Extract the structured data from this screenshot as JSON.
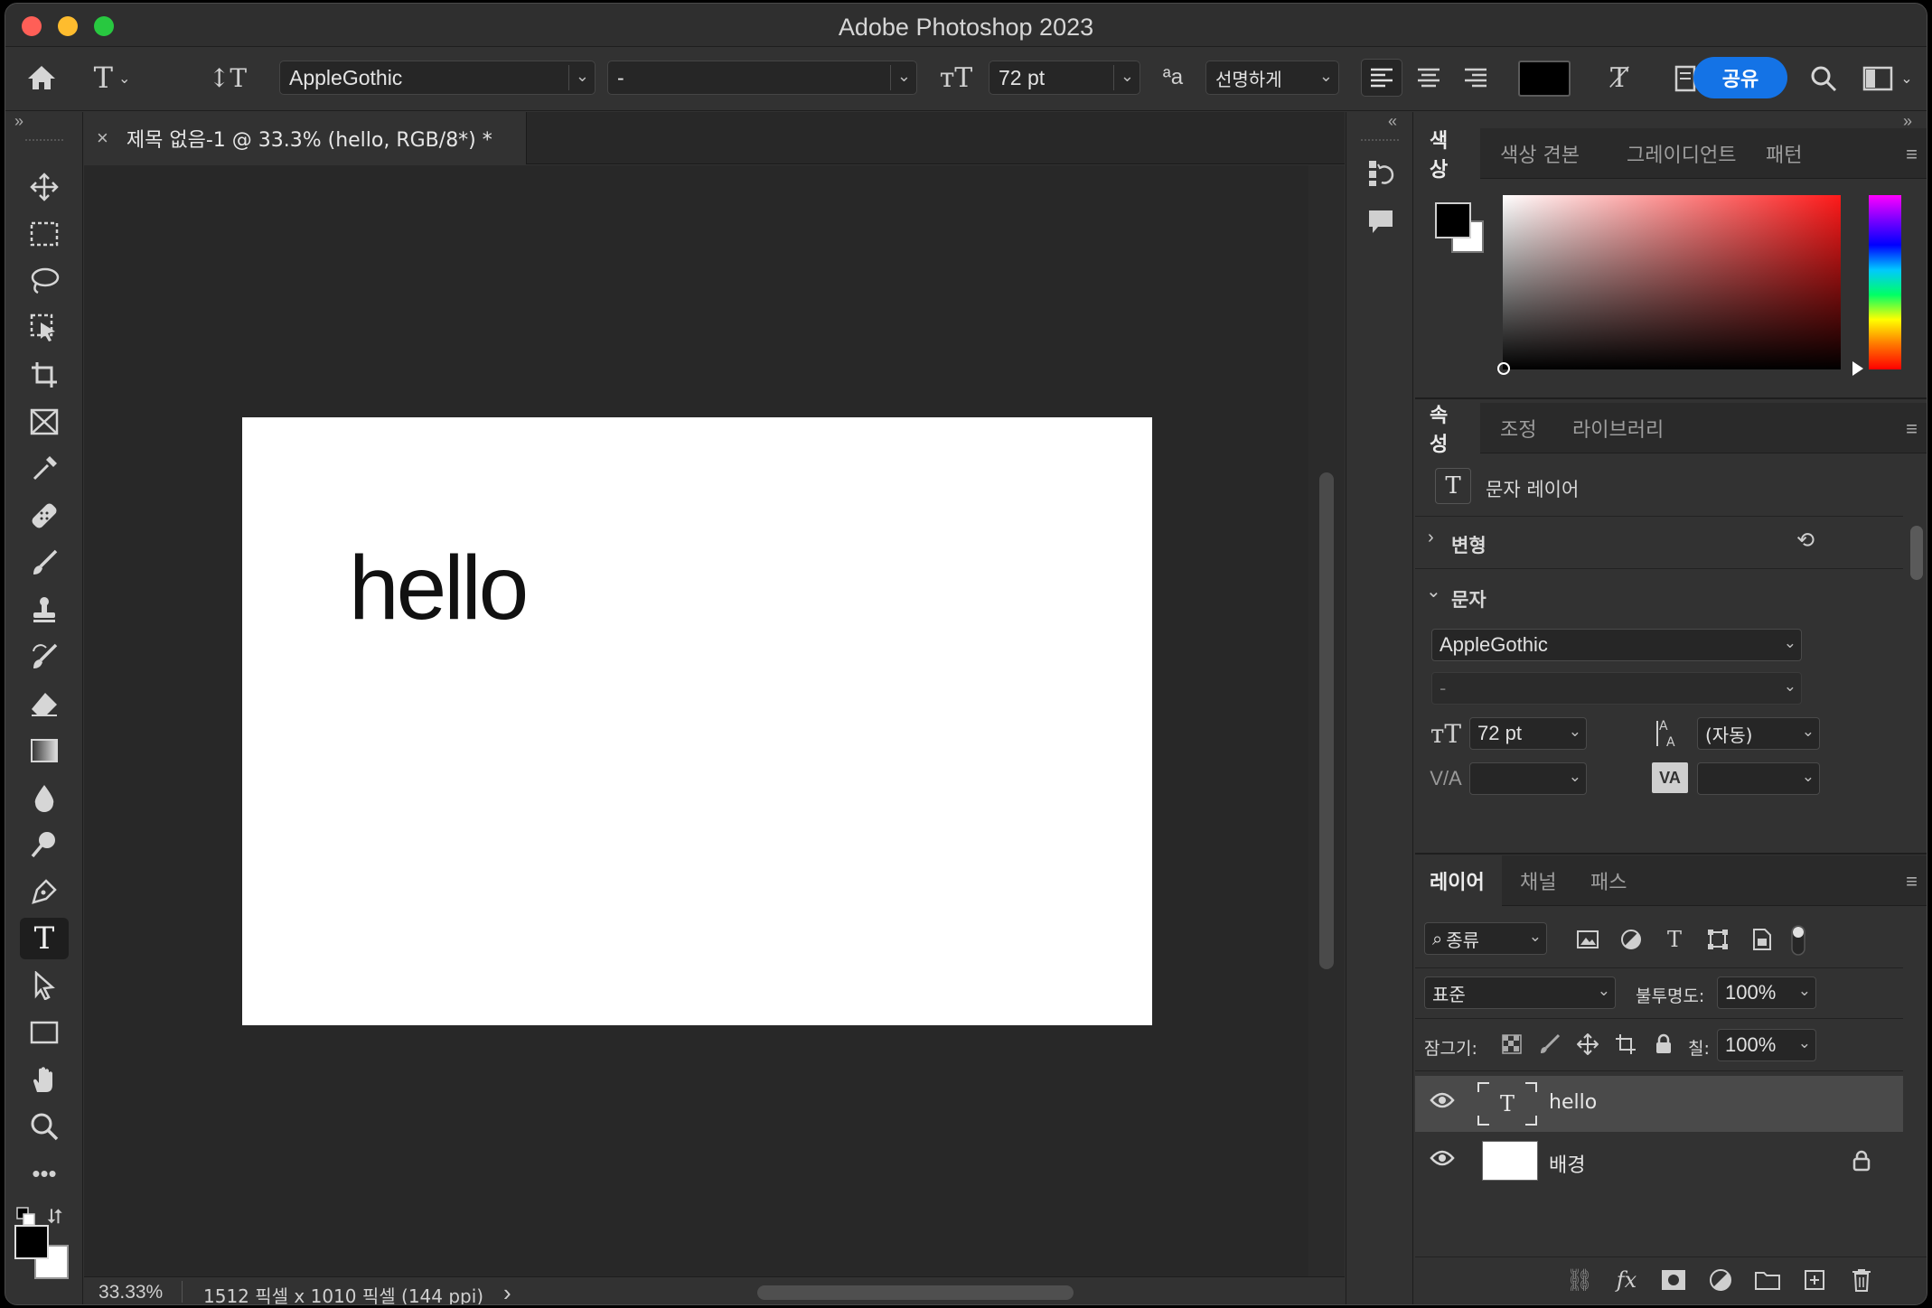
{
  "app": {
    "title": "Adobe Photoshop 2023"
  },
  "options_bar": {
    "font_family": "AppleGothic",
    "font_style": "-",
    "font_size": "72 pt",
    "antialias_glyph": "ªa",
    "antialias": "선명하게",
    "share_label": "공유"
  },
  "document": {
    "tab_title": "제목 없음-1 @ 33.3% (hello, RGB/8*) *",
    "close_glyph": "×",
    "canvas_text": "hello",
    "zoom": "33.33%",
    "dimensions": "1512 픽셀 x 1010 픽셀 (144 ppi)",
    "status_arrow": "›"
  },
  "color_panel": {
    "tabs": [
      "색상",
      "색상 견본",
      "그레이디언트",
      "패턴"
    ],
    "foreground": "#000000",
    "background": "#ffffff"
  },
  "properties_panel": {
    "tabs": [
      "속성",
      "조정",
      "라이브러리"
    ],
    "layer_kind": "문자 레이어",
    "transform_section": "변형",
    "character_section": "문자",
    "font_family": "AppleGothic",
    "font_style": "-",
    "font_size": "72 pt",
    "leading": "(자동)",
    "kerning": "",
    "tracking": "",
    "kerning_label": "V/A",
    "tracking_label": "VA"
  },
  "layers_panel": {
    "tabs": [
      "레이어",
      "채널",
      "패스"
    ],
    "filter_kind": "종류",
    "blend_mode": "표준",
    "opacity_label": "불투명도:",
    "opacity": "100%",
    "lock_label": "잠그기:",
    "fill_label": "칠:",
    "fill": "100%",
    "layers": [
      {
        "name": "hello",
        "type": "text",
        "selected": true
      },
      {
        "name": "배경",
        "type": "background",
        "locked": true
      }
    ]
  },
  "colors": {
    "accent": "#1473e6",
    "panel_bg": "#323232",
    "canvas_bg": "#282828"
  }
}
